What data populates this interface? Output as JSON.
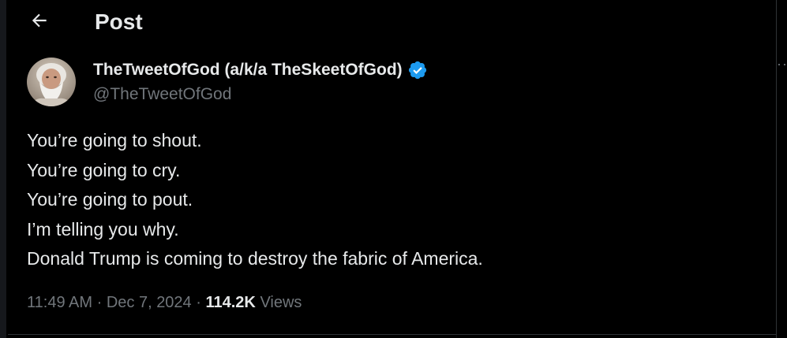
{
  "header": {
    "title": "Post",
    "back_icon": "arrow-left-icon"
  },
  "author": {
    "display_name": "TheTweetOfGod (a/k/a TheSkeetOfGod)",
    "handle": "@TheTweetOfGod",
    "verified": true,
    "verified_color": "#1d9bf0"
  },
  "tweet": {
    "lines": [
      "You’re going to shout.",
      "You’re going to cry.",
      "You’re going to pout.",
      "I’m telling you why.",
      "Donald Trump is coming to destroy the fabric of America."
    ]
  },
  "meta": {
    "time": "11:49 AM",
    "separator": "·",
    "date": "Dec 7, 2024",
    "views_count": "114.2K",
    "views_label": "Views"
  },
  "more": {
    "glyph": "··"
  },
  "colors": {
    "background": "#000000",
    "text_primary": "#e7e9ea",
    "text_secondary": "#71767b",
    "border": "#2f3336",
    "accent": "#1d9bf0"
  }
}
